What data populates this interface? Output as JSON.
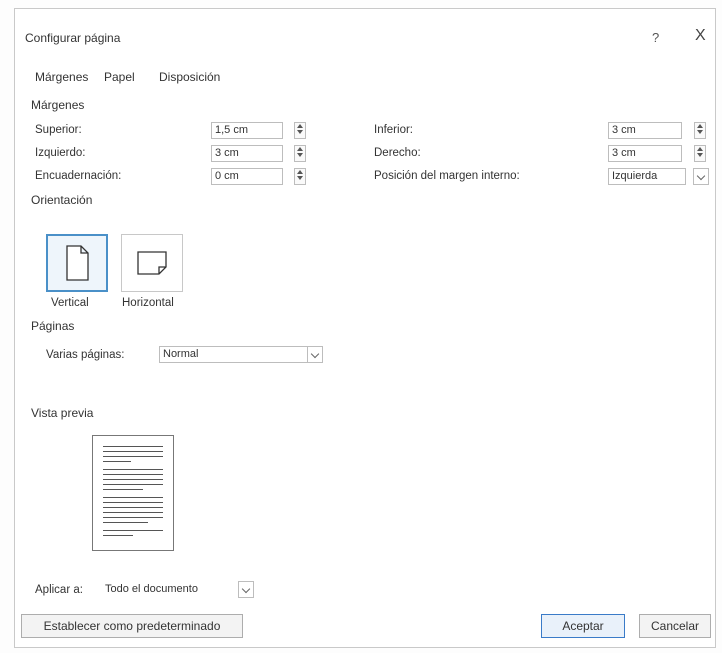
{
  "dialog": {
    "title": "Configurar página",
    "help": "?",
    "close": "X"
  },
  "tabs": [
    "Márgenes",
    "Papel",
    "Disposición"
  ],
  "margins": {
    "section": "Márgenes",
    "superior": {
      "label": "Superior:",
      "value": "1,5 cm"
    },
    "izquierdo": {
      "label": "Izquierdo:",
      "value": "3 cm"
    },
    "encuadernacion": {
      "label": "Encuadernación:",
      "value": "0 cm"
    },
    "inferior": {
      "label": "Inferior:",
      "value": "3 cm"
    },
    "derecho": {
      "label": "Derecho:",
      "value": "3 cm"
    },
    "posicion": {
      "label": "Posición del margen interno:",
      "value": "Izquierda"
    }
  },
  "orientation": {
    "section": "Orientación",
    "vertical": "Vertical",
    "horizontal": "Horizontal"
  },
  "pages": {
    "section": "Páginas",
    "label": "Varias páginas:",
    "value": "Normal"
  },
  "preview": {
    "section": "Vista previa"
  },
  "apply": {
    "label": "Aplicar a:",
    "value": "Todo el documento"
  },
  "buttons": {
    "default": "Establecer como predeterminado",
    "ok": "Aceptar",
    "cancel": "Cancelar"
  },
  "colors": {
    "accent": "#3a7bc8"
  }
}
